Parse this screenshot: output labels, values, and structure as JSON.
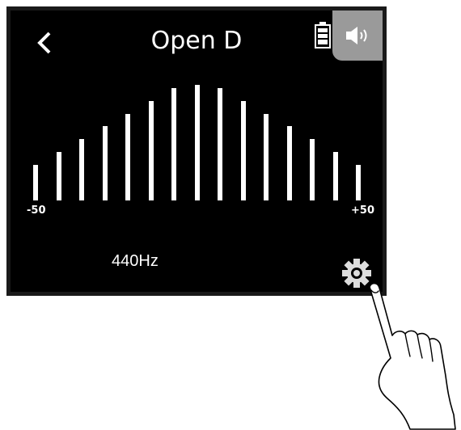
{
  "header": {
    "title": "Open D",
    "back_icon": "chevron-left-icon",
    "battery_icon": "battery-icon",
    "speaker_icon": "speaker-icon"
  },
  "meter": {
    "min_label": "-50",
    "max_label": "+50",
    "levels": [
      0.31,
      0.42,
      0.53,
      0.64,
      0.75,
      0.86,
      0.97,
      1.0,
      0.97,
      0.86,
      0.75,
      0.64,
      0.53,
      0.42,
      0.31
    ]
  },
  "reference": {
    "frequency": "440Hz"
  },
  "settings": {
    "icon": "gear-icon"
  },
  "colors": {
    "background": "#000000",
    "foreground": "#ffffff",
    "speaker_tab": "#9a9a9a"
  }
}
